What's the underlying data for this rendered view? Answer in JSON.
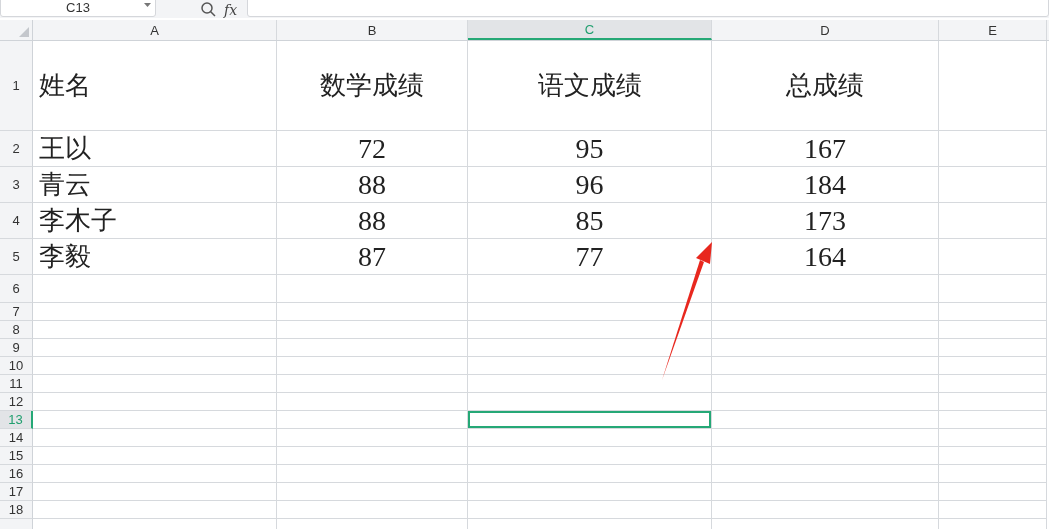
{
  "formula_bar": {
    "name_box": "C13",
    "function_label": "fx"
  },
  "columns": [
    {
      "label": "A",
      "selected": false
    },
    {
      "label": "B",
      "selected": false
    },
    {
      "label": "C",
      "selected": true
    },
    {
      "label": "D",
      "selected": false
    },
    {
      "label": "E",
      "selected": false
    }
  ],
  "rows": [
    {
      "number": "1",
      "selected": false,
      "cells": [
        "姓名",
        "数学成绩",
        "语文成绩",
        "总成绩"
      ]
    },
    {
      "number": "2",
      "selected": false,
      "cells": [
        "王以",
        "72",
        "95",
        "167"
      ]
    },
    {
      "number": "3",
      "selected": false,
      "cells": [
        "青云",
        "88",
        "96",
        "184"
      ]
    },
    {
      "number": "4",
      "selected": false,
      "cells": [
        "李木子",
        "88",
        "85",
        "173"
      ]
    },
    {
      "number": "5",
      "selected": false,
      "cells": [
        "李毅",
        "87",
        "77",
        "164"
      ]
    },
    {
      "number": "6",
      "selected": false,
      "cells": []
    },
    {
      "number": "7",
      "selected": false,
      "cells": []
    },
    {
      "number": "8",
      "selected": false,
      "cells": []
    },
    {
      "number": "9",
      "selected": false,
      "cells": []
    },
    {
      "number": "10",
      "selected": false,
      "cells": []
    },
    {
      "number": "11",
      "selected": false,
      "cells": []
    },
    {
      "number": "12",
      "selected": false,
      "cells": []
    },
    {
      "number": "13",
      "selected": true,
      "cells": []
    },
    {
      "number": "14",
      "selected": false,
      "cells": []
    },
    {
      "number": "15",
      "selected": false,
      "cells": []
    },
    {
      "number": "16",
      "selected": false,
      "cells": []
    },
    {
      "number": "17",
      "selected": false,
      "cells": []
    },
    {
      "number": "18",
      "selected": false,
      "cells": []
    }
  ]
}
